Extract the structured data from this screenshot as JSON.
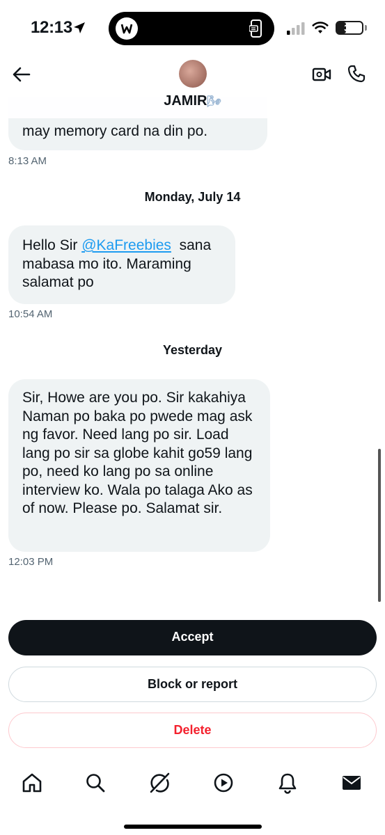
{
  "status_bar": {
    "time": "12:13",
    "battery": "35",
    "battery_level_percent": 35,
    "icons": [
      "location-arrow-icon",
      "app-logo-icon",
      "phone-mirror-icon",
      "cellular-signal-icon",
      "wifi-icon",
      "battery-icon"
    ]
  },
  "header": {
    "contact_name": "JAMIR",
    "name_decoration": "🌬",
    "icons": [
      "back-arrow-icon",
      "video-call-icon",
      "phone-call-icon"
    ]
  },
  "messages": [
    {
      "text": "may memory card na din po.",
      "timestamp": "8:13 AM"
    },
    {
      "day_separator": "Monday, July 14",
      "text_prefix": "Hello Sir ",
      "mention": "@KaFreebies",
      "text_suffix": "  sana mabasa mo ito. Maraming salamat po",
      "timestamp": "10:54 AM"
    },
    {
      "day_separator": "Yesterday",
      "text": "Sir, Howe are you po. Sir kakahiya Naman po baka po pwede mag ask ng favor. Need lang po sir. Load lang po sir sa globe kahit go59 lang po, need ko lang po sa online interview ko. Wala po talaga Ako as of now. Please po. Salamat sir.",
      "timestamp": "12:03 PM"
    }
  ],
  "actions": {
    "accept": "Accept",
    "block_report": "Block or report",
    "delete": "Delete"
  },
  "colors": {
    "accept_bg": "#0f1419",
    "delete_text": "#f4212e",
    "mention": "#1d9bf0",
    "bubble_bg": "#eff3f4",
    "timestamp": "#536471"
  },
  "bottom_nav": [
    "home-icon",
    "search-icon",
    "grok-icon",
    "video-icon",
    "notifications-icon",
    "messages-icon"
  ]
}
